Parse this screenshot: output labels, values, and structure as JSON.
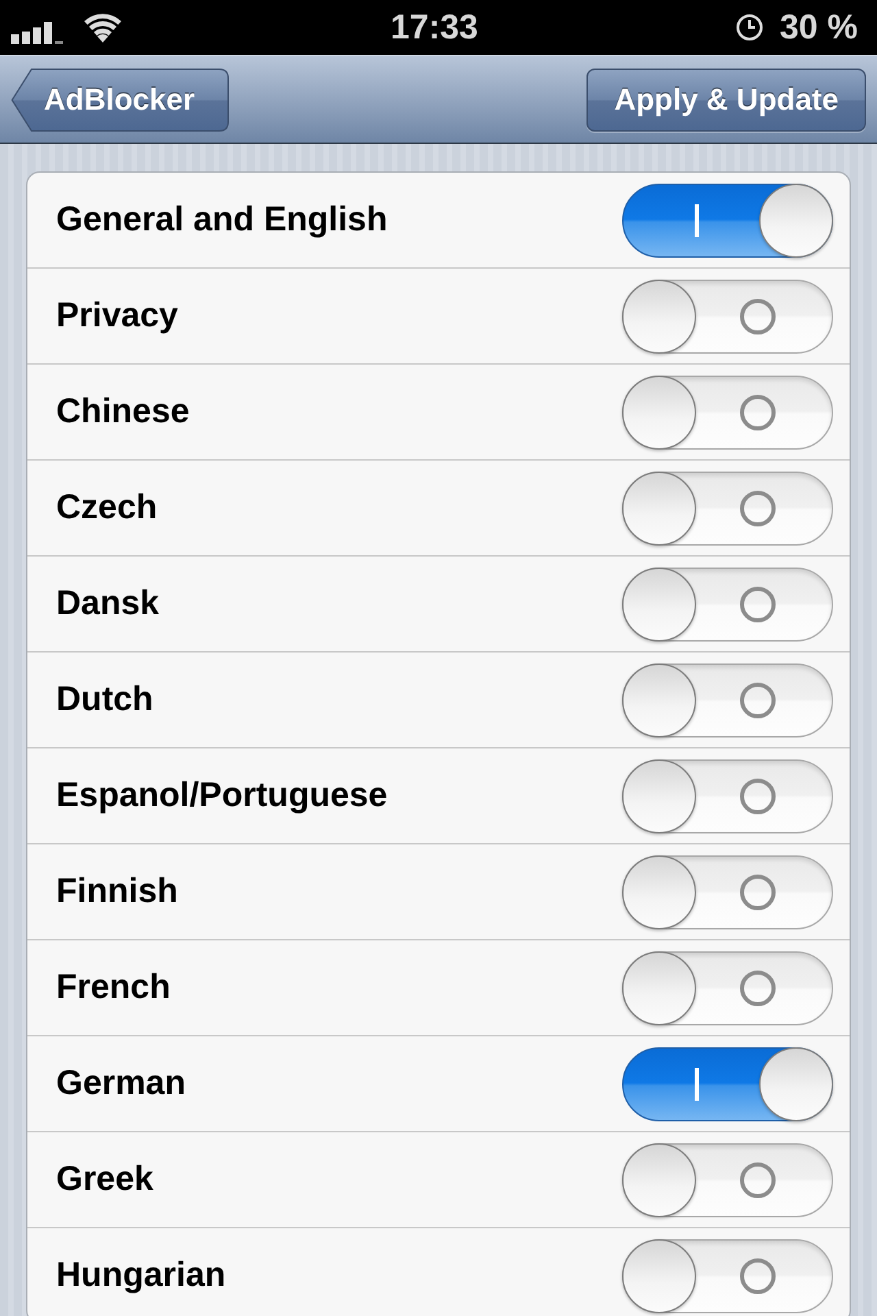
{
  "status_bar": {
    "time": "17:33",
    "battery": "30 %"
  },
  "nav_bar": {
    "back_button": "AdBlocker",
    "action_button": "Apply & Update"
  },
  "filters": [
    {
      "name": "General and English",
      "on": true
    },
    {
      "name": "Privacy",
      "on": false
    },
    {
      "name": "Chinese",
      "on": false
    },
    {
      "name": "Czech",
      "on": false
    },
    {
      "name": "Dansk",
      "on": false
    },
    {
      "name": "Dutch",
      "on": false
    },
    {
      "name": "Espanol/Portuguese",
      "on": false
    },
    {
      "name": "Finnish",
      "on": false
    },
    {
      "name": "French",
      "on": false
    },
    {
      "name": "German",
      "on": true
    },
    {
      "name": "Greek",
      "on": false
    },
    {
      "name": "Hungarian",
      "on": false
    }
  ]
}
